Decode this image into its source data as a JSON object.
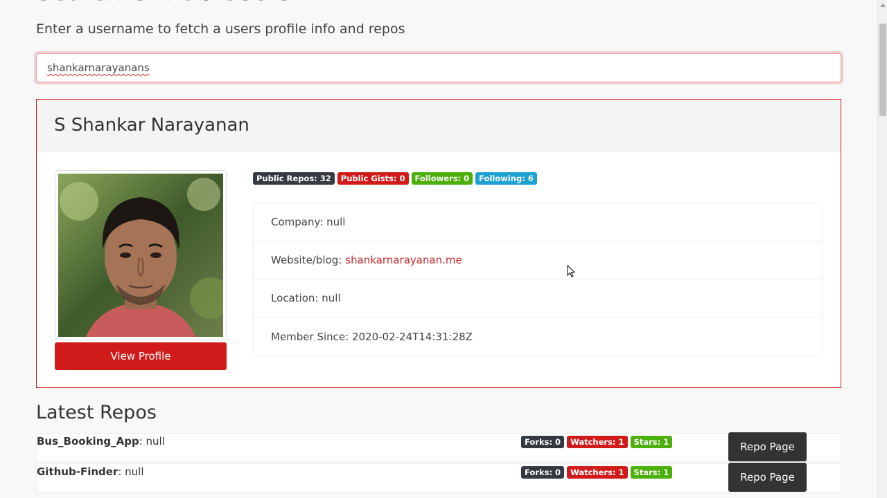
{
  "header": {
    "title": "Search Github Users",
    "lead": "Enter a username to fetch a users profile info and repos"
  },
  "search": {
    "value": "shankarnarayanans"
  },
  "profile": {
    "name": "S Shankar Narayanan",
    "view_profile_label": "View Profile",
    "badges": {
      "public_repos": "Public Repos: 32",
      "public_gists": "Public Gists: 0",
      "followers": "Followers: 0",
      "following": "Following: 6"
    },
    "company_label": "Company: null",
    "website_label": "Website/blog:",
    "website_value": "shankarnarayanan.me",
    "location_label": "Location: null",
    "member_since_label": "Member Since: 2020-02-24T14:31:28Z"
  },
  "repos": {
    "title": "Latest Repos",
    "items": [
      {
        "name": "Bus_Booking_App",
        "description": ": null",
        "forks": "Forks: 0",
        "watchers": "Watchers: 1",
        "stars": "Stars: 1",
        "button": "Repo Page"
      },
      {
        "name": "Github-Finder",
        "description": ": null",
        "forks": "Forks: 0",
        "watchers": "Watchers: 1",
        "stars": "Stars: 1",
        "button": "Repo Page"
      }
    ]
  },
  "colors": {
    "accent_red": "#d11a1a",
    "badge_dark": "#343a40",
    "badge_green": "#4caf0a",
    "badge_blue": "#1da1d2"
  }
}
